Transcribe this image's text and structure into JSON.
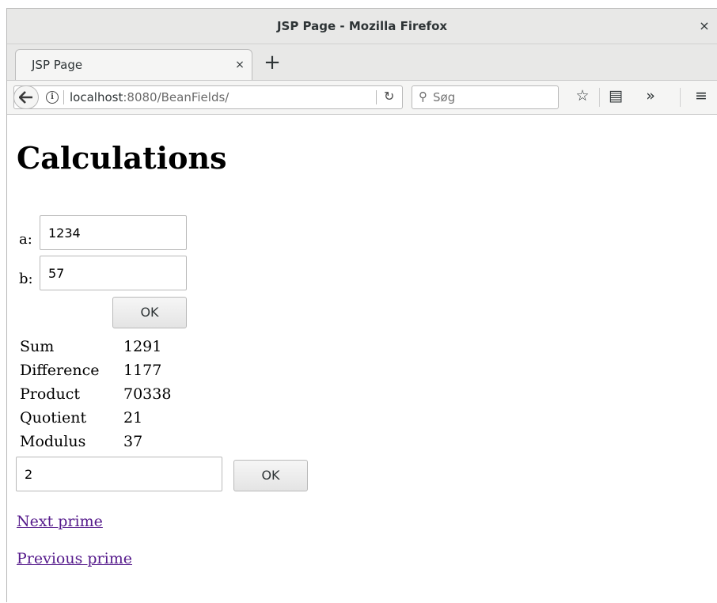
{
  "window": {
    "title": "JSP Page - Mozilla Firefox",
    "close": "×"
  },
  "tab": {
    "title": "JSP Page",
    "close": "×",
    "new_tab": "+"
  },
  "navbar": {
    "url_host": "localhost",
    "url_rest": ":8080/BeanFields/",
    "search_placeholder": "Søg",
    "overflow": "»"
  },
  "page": {
    "heading": "Calculations",
    "form": {
      "a_label": "a:",
      "a_value": "1234",
      "b_label": "b:",
      "b_value": "57",
      "ok_label": "OK"
    },
    "results": [
      {
        "label": "Sum",
        "value": "1291"
      },
      {
        "label": "Difference",
        "value": "1177"
      },
      {
        "label": "Product",
        "value": "70338"
      },
      {
        "label": "Quotient",
        "value": "21"
      },
      {
        "label": "Modulus",
        "value": "37"
      }
    ],
    "prime_form": {
      "value": "2",
      "ok_label": "OK"
    },
    "links": {
      "next": "Next prime",
      "previous": "Previous prime"
    }
  }
}
